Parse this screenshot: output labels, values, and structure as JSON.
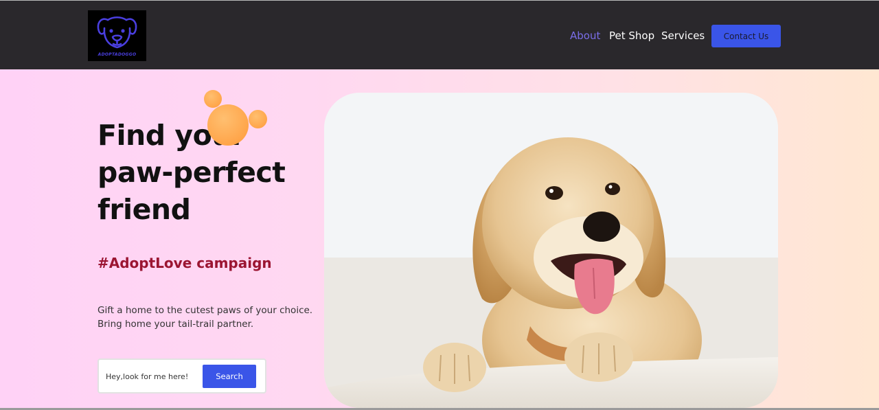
{
  "header": {
    "logo_text": "ADOPTADOGGO",
    "nav": [
      {
        "label": "About",
        "active": true
      },
      {
        "label": "Pet Shop",
        "active": false
      },
      {
        "label": "Services",
        "active": false
      }
    ],
    "contact_label": "Contact Us"
  },
  "hero": {
    "headline": "Find your paw-perfect friend",
    "campaign": "#AdoptLove campaign",
    "description_line1": "Gift a home to the cutest paws of your choice.",
    "description_line2": "Bring home your tail-trail partner.",
    "search": {
      "placeholder": "Hey,look for me here!",
      "button_label": "Search"
    }
  },
  "colors": {
    "accent": "#3a55e8",
    "nav_background": "#2a282c",
    "active_nav": "#7a6ee8",
    "campaign_text": "#9b1532",
    "blob": "#ff9a3a"
  },
  "icons": {
    "logo": "dog-face-icon",
    "decoration": "orange-bubbles"
  }
}
